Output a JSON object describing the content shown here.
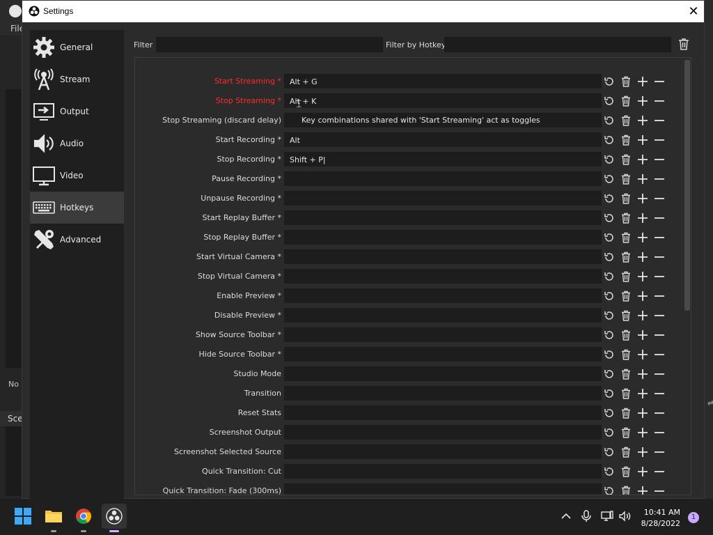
{
  "background": {
    "menu_file": "File",
    "no_source": "No s",
    "scenes_label": "Sce"
  },
  "dialog": {
    "title": "Settings",
    "close": "✕"
  },
  "sidebar": {
    "items": [
      {
        "label": "General",
        "icon": "gear-icon"
      },
      {
        "label": "Stream",
        "icon": "antenna-icon"
      },
      {
        "label": "Output",
        "icon": "output-icon"
      },
      {
        "label": "Audio",
        "icon": "speaker-icon"
      },
      {
        "label": "Video",
        "icon": "monitor-icon"
      },
      {
        "label": "Hotkeys",
        "icon": "keyboard-icon",
        "active": true
      },
      {
        "label": "Advanced",
        "icon": "tools-icon"
      }
    ]
  },
  "filter": {
    "label": "Filter",
    "value": "",
    "hotkey_label": "Filter by Hotkey",
    "hotkey_value": ""
  },
  "hotkeys": [
    {
      "label": "Start Streaming *",
      "value": "Alt + G",
      "conflict": true
    },
    {
      "label": "Stop Streaming *",
      "value": "Alt + K",
      "conflict": true
    },
    {
      "label": "Stop Streaming (discard delay)",
      "value": ""
    },
    {
      "label": "Start Recording *",
      "value": "Alt"
    },
    {
      "label": "Stop Recording *",
      "value": "Shift + P|"
    },
    {
      "label": "Pause Recording *",
      "value": ""
    },
    {
      "label": "Unpause Recording *",
      "value": ""
    },
    {
      "label": "Start Replay Buffer *",
      "value": ""
    },
    {
      "label": "Stop Replay Buffer *",
      "value": ""
    },
    {
      "label": "Start Virtual Camera *",
      "value": ""
    },
    {
      "label": "Stop Virtual Camera *",
      "value": ""
    },
    {
      "label": "Enable Preview *",
      "value": ""
    },
    {
      "label": "Disable Preview *",
      "value": ""
    },
    {
      "label": "Show Source Toolbar *",
      "value": ""
    },
    {
      "label": "Hide Source Toolbar *",
      "value": ""
    },
    {
      "label": "Studio Mode",
      "value": ""
    },
    {
      "label": "Transition",
      "value": ""
    },
    {
      "label": "Reset Stats",
      "value": ""
    },
    {
      "label": "Screenshot Output",
      "value": ""
    },
    {
      "label": "Screenshot Selected Source",
      "value": ""
    },
    {
      "label": "Quick Transition: Cut",
      "value": ""
    },
    {
      "label": "Quick Transition: Fade (300ms)",
      "value": ""
    }
  ],
  "tooltip": "Key combinations shared with 'Start Streaming' act as toggles",
  "taskbar": {
    "time": "10:41 AM",
    "date": "8/28/2022",
    "badge": "1"
  },
  "colors": {
    "conflict": "#ff2b2b",
    "dialog_bg": "#2b2b2b",
    "input_bg": "#1d1d1d"
  }
}
